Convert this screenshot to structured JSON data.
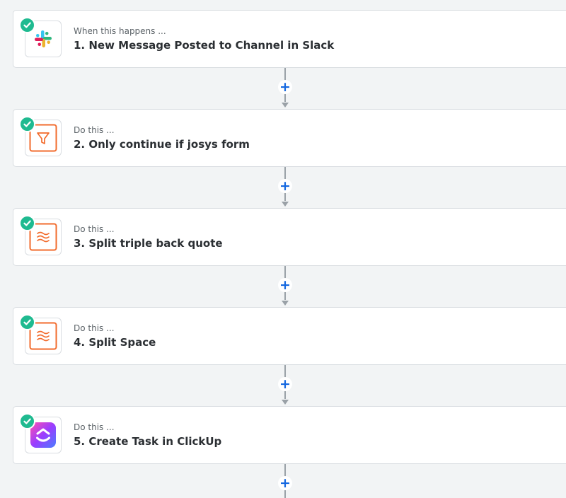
{
  "steps": [
    {
      "kicker": "When this happens ...",
      "title": "1. New Message Posted to Channel in Slack",
      "icon": "slack-icon"
    },
    {
      "kicker": "Do this ...",
      "title": "2. Only continue if josys form",
      "icon": "filter-icon"
    },
    {
      "kicker": "Do this ...",
      "title": "3. Split triple back quote",
      "icon": "formatter-icon"
    },
    {
      "kicker": "Do this ...",
      "title": "4. Split Space",
      "icon": "formatter-icon"
    },
    {
      "kicker": "Do this ...",
      "title": "5. Create Task in ClickUp",
      "icon": "clickup-icon"
    }
  ],
  "add_step_symbol": "+",
  "colors": {
    "check_green": "#1fba90",
    "add_blue": "#1568e0",
    "formatter_orange": "#f26b2c",
    "connector_gray": "#9aa1a7"
  }
}
